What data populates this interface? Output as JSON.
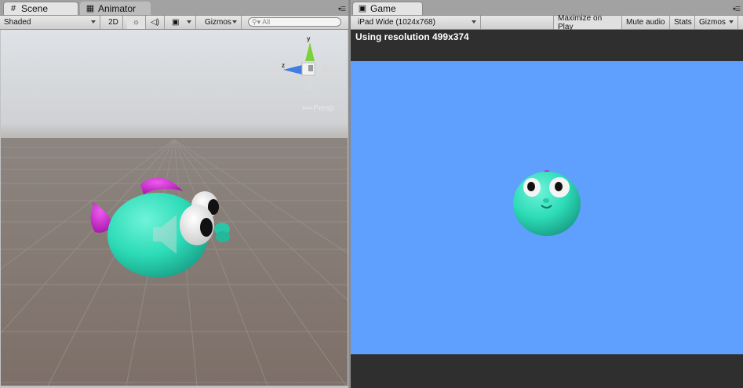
{
  "scene": {
    "tabs": [
      {
        "label": "Scene",
        "icon": "grid-icon"
      },
      {
        "label": "Animator",
        "icon": "animator-icon"
      }
    ],
    "toolbar": {
      "shading_mode": "Shaded",
      "mode_2d": "2D",
      "gizmos_label": "Gizmos",
      "search_placeholder": "All"
    },
    "gizmo": {
      "y_label": "y",
      "z_label": "z",
      "projection_label": "Persp"
    }
  },
  "game": {
    "tab_label": "Game",
    "toolbar": {
      "aspect": "iPad Wide (1024x768)",
      "maximize_on_play": "Maximize on Play",
      "mute_audio": "Mute audio",
      "stats": "Stats",
      "gizmos": "Gizmos"
    },
    "resolution_text": "Using resolution 499x374",
    "background_color": "#5f9ffd"
  },
  "colors": {
    "fish_body": "#2ddcb8",
    "fish_fin": "#d21fd0",
    "sky": "#d9dde2",
    "ground": "#877a73"
  }
}
